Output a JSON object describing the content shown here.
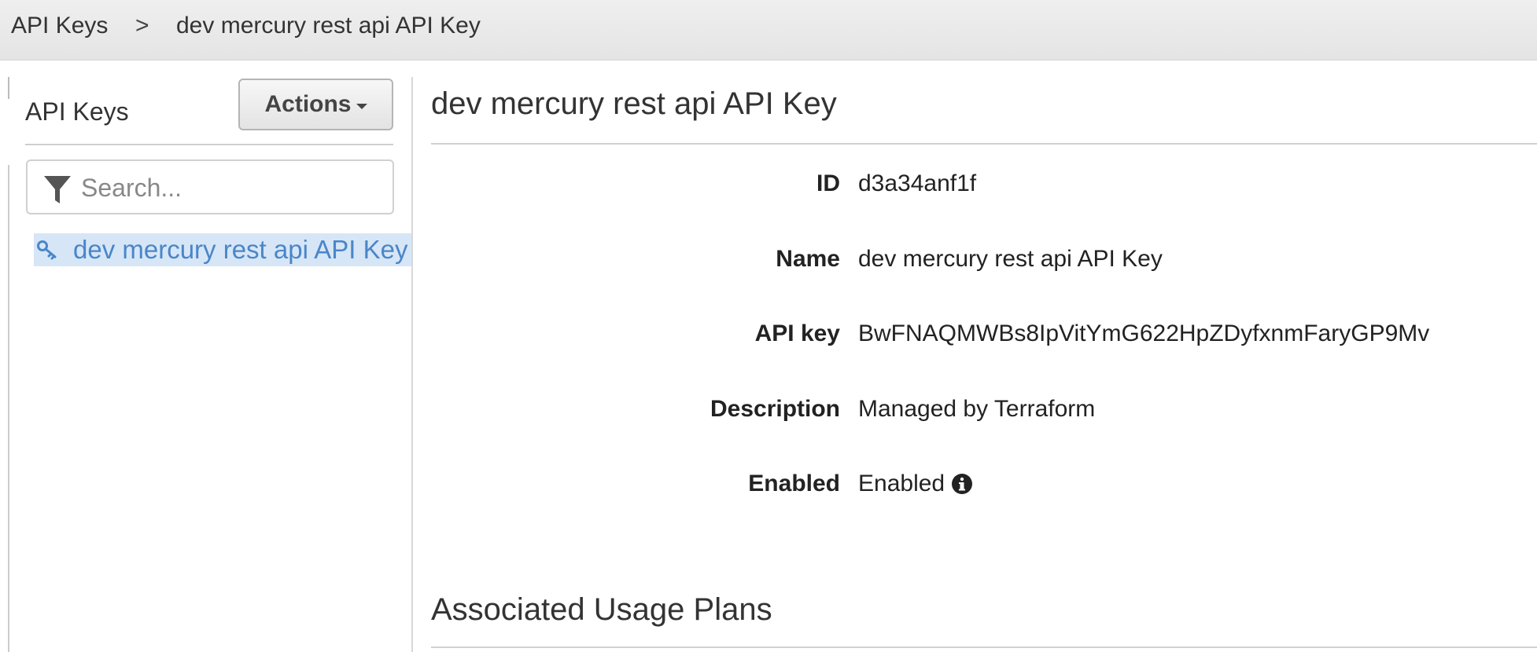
{
  "breadcrumb": {
    "root": "API Keys",
    "separator": ">",
    "current": "dev mercury rest api API Key"
  },
  "sidebar": {
    "title": "API Keys",
    "actions_label": "Actions",
    "search_placeholder": "Search...",
    "items": [
      {
        "label": "dev mercury rest api API Key",
        "icon": "key-icon",
        "selected": true
      }
    ]
  },
  "detail": {
    "title": "dev mercury rest api API Key",
    "fields": [
      {
        "label": "ID",
        "value": "d3a34anf1f"
      },
      {
        "label": "Name",
        "value": "dev mercury rest api API Key"
      },
      {
        "label": "API key",
        "value": "BwFNAQMWBs8IpVitYmG622HpZDyfxnmFaryGP9Mv"
      },
      {
        "label": "Description",
        "value": "Managed by Terraform"
      },
      {
        "label": "Enabled",
        "value": "Enabled",
        "icon": "info-icon"
      }
    ],
    "section_title": "Associated Usage Plans"
  },
  "colors": {
    "selection_bg": "#d6e6f7",
    "link": "#4a86c8"
  }
}
